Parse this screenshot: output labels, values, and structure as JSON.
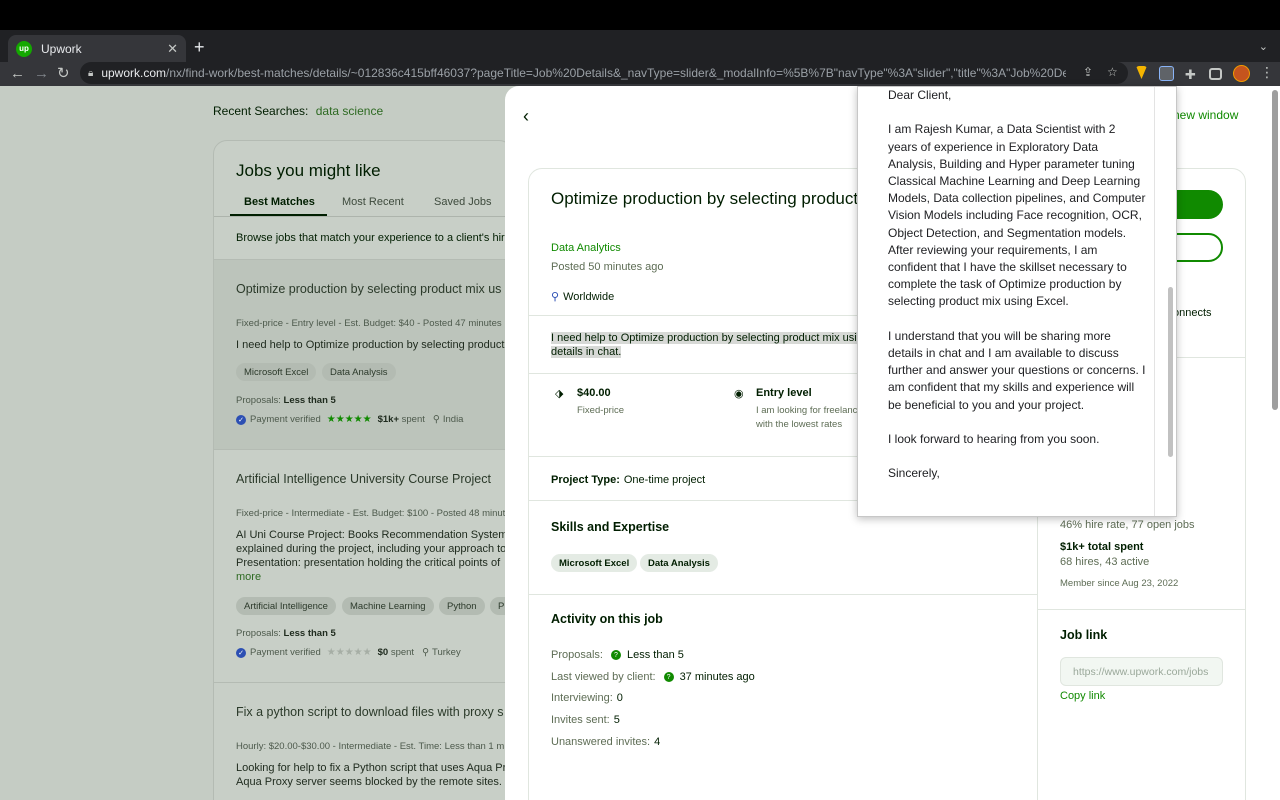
{
  "browser": {
    "tab_title": "Upwork",
    "tab_favicon": "up",
    "url_domain": "upwork.com",
    "url_path": "/nx/find-work/best-matches/details/~012836c415bff46037?pageTitle=Job%20Details&_navType=slider&_modalInfo=%5B%7B\"navType\"%3A\"slider\",\"title\"%3A\"Job%20Details\",\"mo...",
    "icons": [
      "back-icon",
      "forward-icon",
      "reload-icon",
      "lock-icon",
      "share-icon",
      "star-icon",
      "extension-icon",
      "puzzle-icon",
      "sidepanel-icon",
      "profile-avatar",
      "kebab-icon"
    ]
  },
  "page": {
    "recent_label": "Recent Searches:",
    "recent_link": "data science",
    "jobs_title": "Jobs you might like",
    "tabs": [
      "Best Matches",
      "Most Recent",
      "Saved Jobs"
    ],
    "browse": "Browse jobs that match your experience to a client's hiri",
    "jobs": [
      {
        "title": "Optimize production by selecting product mix us",
        "meta_type": "Fixed-price",
        "meta_rest": " - Entry level - Est. Budget: $40 - Posted 47 minutes",
        "desc": "I need help to Optimize production by selecting product",
        "chips": [
          "Microsoft Excel",
          "Data Analysis"
        ],
        "proposals_label": "Proposals:",
        "proposals": "Less than 5",
        "verified": "Payment verified",
        "stars": "★★★★★",
        "spent": "$1k+",
        "spent_label": "spent",
        "country": "India"
      },
      {
        "title": "Artificial Intelligence University Course Project",
        "meta_type": "Fixed-price",
        "meta_rest": " - Intermediate - Est. Budget: $100 - Posted 48 minut",
        "desc": "AI Uni Course Project: Books Recommendation System. explained during the project, including your approach to Presentation: presentation holding the critical points of",
        "more": "more",
        "chips": [
          "Artificial Intelligence",
          "Machine Learning",
          "Python",
          "Pr"
        ],
        "proposals_label": "Proposals:",
        "proposals": "Less than 5",
        "verified": "Payment verified",
        "stars": "★★★★★",
        "spent": "$0",
        "spent_label": "spent",
        "country": "Turkey"
      },
      {
        "title": "Fix a python script to download files with proxy s",
        "meta_type": "Hourly: $20.00-$30.00",
        "meta_rest": " - Intermediate - Est. Time: Less than 1 m",
        "desc": "Looking for help to fix a Python script that uses Aqua Pr Aqua Proxy server seems blocked by the remote sites. N"
      }
    ]
  },
  "details": {
    "new_window": "new window",
    "title": "Optimize production by selecting product",
    "category": "Data Analytics",
    "posted": "Posted 50 minutes ago",
    "location": "Worldwide",
    "description_line1": "I need help to Optimize production by selecting product mix usi",
    "description_line2": "details in chat.",
    "price": "$40.00",
    "price_label": "Fixed-price",
    "level": "Entry level",
    "level_desc": "I am looking for freelancers with the lowest rates",
    "project_type_label": "Project Type:",
    "project_type": "One-time project",
    "skills_title": "Skills and Expertise",
    "skills": [
      "Microsoft Excel",
      "Data Analysis"
    ],
    "activity_title": "Activity on this job",
    "activity": {
      "proposals_label": "Proposals:",
      "proposals": "Less than 5",
      "last_viewed_label": "Last viewed by client:",
      "last_viewed": "37 minutes ago",
      "interviewing_label": "Interviewing:",
      "interviewing": "0",
      "invites_label": "Invites sent:",
      "invites": "5",
      "unanswered_label": "Unanswered invites:",
      "unanswered": "4"
    },
    "side": {
      "link_fragment": "ate",
      "connects_fragment": "onnects",
      "hire_rate": "46% hire rate, 77 open jobs",
      "total_spent": "$1k+ total spent",
      "hires": "68 hires, 43 active",
      "member_since": "Member since Aug 23, 2022",
      "job_link_title": "Job link",
      "job_link_value": "https://www.upwork.com/jobs",
      "copy_link": "Copy link"
    }
  },
  "popup": {
    "letter": "Dear Client,\n\nI am Rajesh Kumar, a Data Scientist with 2 years of experience in Exploratory Data Analysis, Building and Hyper parameter tuning Classical Machine Learning and Deep Learning Models, Data collection pipelines, and Computer Vision Models including Face recognition, OCR, Object Detection, and Segmentation models. After reviewing your requirements, I am confident that I have the skillset necessary to complete the task of Optimize production by selecting product mix using Excel.\n\nI understand that you will be sharing more details in chat and I am available to discuss further and answer your questions or concerns. I am confident that my skills and experience will be beneficial to you and your project.\n\nI look forward to hearing from you soon.\n\nSincerely,"
  }
}
